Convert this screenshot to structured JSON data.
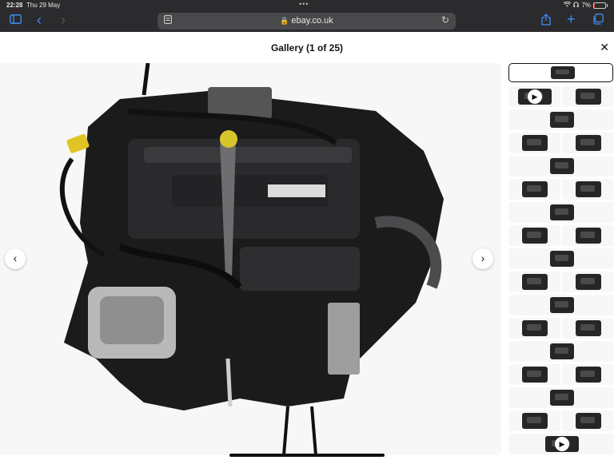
{
  "status": {
    "time": "22:28",
    "date": "Thu 29 May",
    "battery_percent": "7%",
    "battery_level": 0.07
  },
  "browser": {
    "url": "ebay.co.uk"
  },
  "gallery": {
    "title": "Gallery (1 of 25)",
    "close_glyph": "✕"
  },
  "nav": {
    "prev_glyph": "‹",
    "next_glyph": "›"
  },
  "icons": {
    "sidebar": "sidebar-icon",
    "back": "chevron-left-icon",
    "forward": "chevron-right-icon",
    "share": "share-icon",
    "add_tab": "plus-icon",
    "tabs": "tabs-icon",
    "lock": "lock-icon",
    "reload": "reload-icon",
    "page": "page-menu-icon",
    "wifi": "wifi-icon",
    "headphones": "headphones-icon",
    "battery": "battery-icon",
    "play": "play-icon"
  },
  "colors": {
    "accent": "#3e8ef7",
    "chrome": "#2b2b2d",
    "battery_low": "#e04040"
  },
  "thumbnails": [
    {
      "type": "single",
      "selected": true
    },
    {
      "type": "pair",
      "left_video": true
    },
    {
      "type": "single"
    },
    {
      "type": "pair"
    },
    {
      "type": "single"
    },
    {
      "type": "pair"
    },
    {
      "type": "single"
    },
    {
      "type": "pair"
    },
    {
      "type": "single"
    },
    {
      "type": "pair"
    },
    {
      "type": "single"
    },
    {
      "type": "pair"
    },
    {
      "type": "single"
    },
    {
      "type": "pair"
    },
    {
      "type": "single"
    },
    {
      "type": "pair"
    },
    {
      "type": "single",
      "video": true
    }
  ]
}
